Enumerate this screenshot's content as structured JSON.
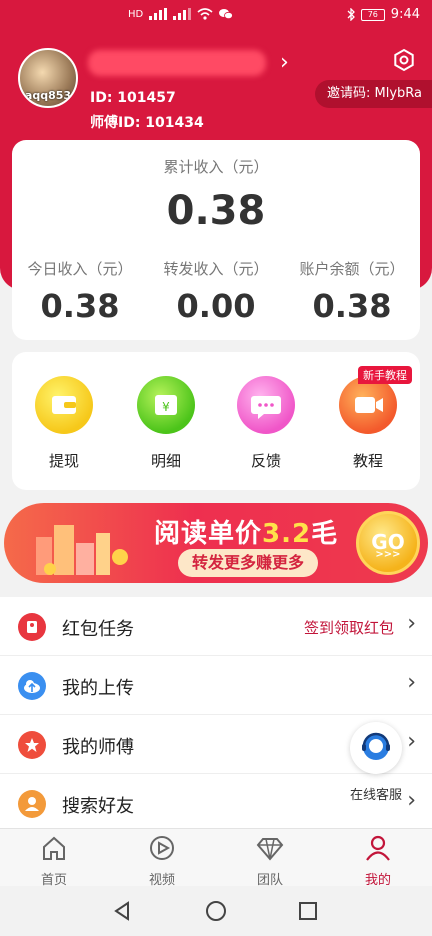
{
  "status_bar": {
    "time": "9:44",
    "network": "HD",
    "battery": "76"
  },
  "profile": {
    "avatar_text": "aqq853",
    "user_id_label": "ID: 101457",
    "master_id_label": "师傅ID:  101434",
    "invite_code": "邀请码: MlybRa"
  },
  "earnings": {
    "total_label": "累计收入（元）",
    "total_value": "0.38",
    "stats": [
      {
        "label": "今日收入（元）",
        "value": "0.38"
      },
      {
        "label": "转发收入（元）",
        "value": "0.00"
      },
      {
        "label": "账户余额（元）",
        "value": "0.38"
      }
    ]
  },
  "menu": {
    "items": [
      {
        "label": "提现",
        "icon": "wallet-icon"
      },
      {
        "label": "明细",
        "icon": "calendar-yuan-icon"
      },
      {
        "label": "反馈",
        "icon": "chat-icon"
      },
      {
        "label": "教程",
        "icon": "video-icon"
      }
    ],
    "badge": "新手教程"
  },
  "banner": {
    "title_prefix": "阅读单价",
    "title_number": "3.2",
    "title_suffix": "毛",
    "subtitle": "转发更多赚更多",
    "go": "GO",
    "go_arrows": ">>>"
  },
  "list": {
    "items": [
      {
        "label": "红包任务",
        "hint": "签到领取红包",
        "icon": "red-envelope-icon",
        "color": "#e8363f"
      },
      {
        "label": "我的上传",
        "hint": "",
        "icon": "cloud-upload-icon",
        "color": "#3a8ff0"
      },
      {
        "label": "我的师傅",
        "hint": "",
        "icon": "star-icon",
        "color": "#ef4d3c"
      },
      {
        "label": "搜索好友",
        "hint": "",
        "icon": "person-icon",
        "color": "#f39a3a"
      }
    ]
  },
  "service": {
    "label": "在线客服"
  },
  "tabs": [
    {
      "label": "首页",
      "icon": "home-icon"
    },
    {
      "label": "视频",
      "icon": "play-icon"
    },
    {
      "label": "团队",
      "icon": "diamond-icon"
    },
    {
      "label": "我的",
      "icon": "user-icon",
      "active": true
    }
  ],
  "colors": {
    "brand": "#d8183e",
    "accent_text": "#c2153a"
  }
}
